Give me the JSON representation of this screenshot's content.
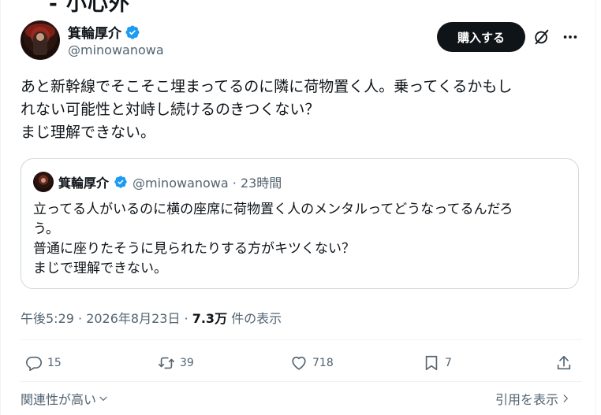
{
  "top_cut_text": "- 小心外",
  "author": {
    "display_name": "箕輪厚介",
    "handle": "@minowanowa",
    "avatar_icon": "avatar-photo",
    "verified_icon": "verified-badge-icon"
  },
  "header": {
    "buy_label": "購入する",
    "grok_icon": "grok-icon",
    "more_icon": "more-options-icon"
  },
  "tweet": {
    "lines": [
      "あと新幹線でそこそこ埋まってるのに隣に荷物置く人。乗ってくるかもし",
      "れない可能性と対峙し続けるのきつくない？",
      "まじ理解できない。"
    ]
  },
  "quote": {
    "display_name": "箕輪厚介",
    "handle_time": "@minowanowa · 23時間",
    "lines": [
      "立ってる人がいるのに横の座席に荷物置く人のメンタルってどうなってるんだろ",
      "う。",
      "普通に座りたそうに見られたりする方がキツくない？",
      "まじで理解できない。"
    ]
  },
  "meta": {
    "time": "午後5:29 · 2026年8月23日 · ",
    "views": "7.3万",
    "views_suffix": " 件の表示"
  },
  "actions": {
    "reply_count": "15",
    "retweet_count": "39",
    "like_count": "718",
    "bookmark_count": "7"
  },
  "footer": {
    "relevance_label": "関連性が高い",
    "quotes_label": "引用を表示"
  },
  "colors": {
    "text": "#0f1419",
    "secondary": "#536471",
    "verified": "#1d9bf0",
    "border": "#cfd9de"
  }
}
